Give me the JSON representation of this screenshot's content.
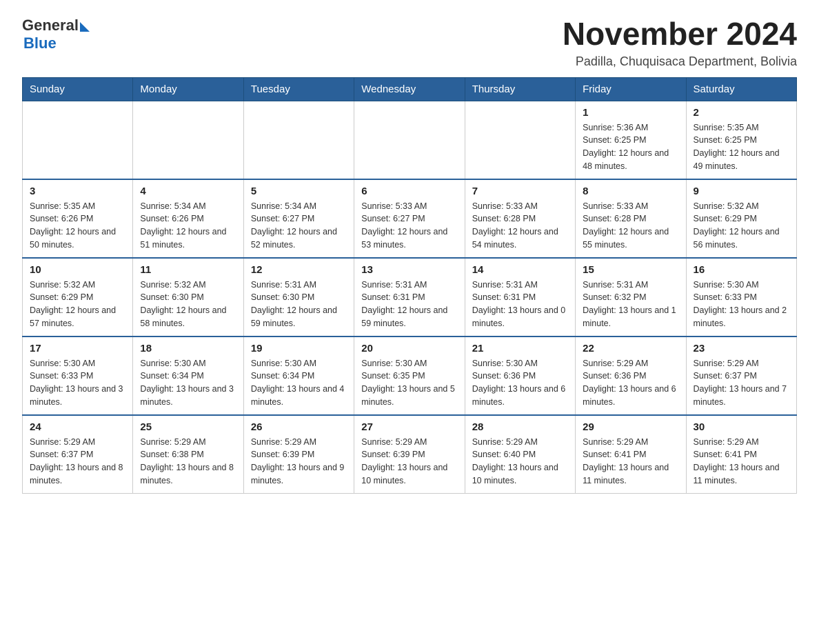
{
  "logo": {
    "general": "General",
    "blue": "Blue",
    "line2": "Blue"
  },
  "header": {
    "title": "November 2024",
    "subtitle": "Padilla, Chuquisaca Department, Bolivia"
  },
  "days_of_week": [
    "Sunday",
    "Monday",
    "Tuesday",
    "Wednesday",
    "Thursday",
    "Friday",
    "Saturday"
  ],
  "weeks": [
    [
      {
        "day": "",
        "info": ""
      },
      {
        "day": "",
        "info": ""
      },
      {
        "day": "",
        "info": ""
      },
      {
        "day": "",
        "info": ""
      },
      {
        "day": "",
        "info": ""
      },
      {
        "day": "1",
        "info": "Sunrise: 5:36 AM\nSunset: 6:25 PM\nDaylight: 12 hours and 48 minutes."
      },
      {
        "day": "2",
        "info": "Sunrise: 5:35 AM\nSunset: 6:25 PM\nDaylight: 12 hours and 49 minutes."
      }
    ],
    [
      {
        "day": "3",
        "info": "Sunrise: 5:35 AM\nSunset: 6:26 PM\nDaylight: 12 hours and 50 minutes."
      },
      {
        "day": "4",
        "info": "Sunrise: 5:34 AM\nSunset: 6:26 PM\nDaylight: 12 hours and 51 minutes."
      },
      {
        "day": "5",
        "info": "Sunrise: 5:34 AM\nSunset: 6:27 PM\nDaylight: 12 hours and 52 minutes."
      },
      {
        "day": "6",
        "info": "Sunrise: 5:33 AM\nSunset: 6:27 PM\nDaylight: 12 hours and 53 minutes."
      },
      {
        "day": "7",
        "info": "Sunrise: 5:33 AM\nSunset: 6:28 PM\nDaylight: 12 hours and 54 minutes."
      },
      {
        "day": "8",
        "info": "Sunrise: 5:33 AM\nSunset: 6:28 PM\nDaylight: 12 hours and 55 minutes."
      },
      {
        "day": "9",
        "info": "Sunrise: 5:32 AM\nSunset: 6:29 PM\nDaylight: 12 hours and 56 minutes."
      }
    ],
    [
      {
        "day": "10",
        "info": "Sunrise: 5:32 AM\nSunset: 6:29 PM\nDaylight: 12 hours and 57 minutes."
      },
      {
        "day": "11",
        "info": "Sunrise: 5:32 AM\nSunset: 6:30 PM\nDaylight: 12 hours and 58 minutes."
      },
      {
        "day": "12",
        "info": "Sunrise: 5:31 AM\nSunset: 6:30 PM\nDaylight: 12 hours and 59 minutes."
      },
      {
        "day": "13",
        "info": "Sunrise: 5:31 AM\nSunset: 6:31 PM\nDaylight: 12 hours and 59 minutes."
      },
      {
        "day": "14",
        "info": "Sunrise: 5:31 AM\nSunset: 6:31 PM\nDaylight: 13 hours and 0 minutes."
      },
      {
        "day": "15",
        "info": "Sunrise: 5:31 AM\nSunset: 6:32 PM\nDaylight: 13 hours and 1 minute."
      },
      {
        "day": "16",
        "info": "Sunrise: 5:30 AM\nSunset: 6:33 PM\nDaylight: 13 hours and 2 minutes."
      }
    ],
    [
      {
        "day": "17",
        "info": "Sunrise: 5:30 AM\nSunset: 6:33 PM\nDaylight: 13 hours and 3 minutes."
      },
      {
        "day": "18",
        "info": "Sunrise: 5:30 AM\nSunset: 6:34 PM\nDaylight: 13 hours and 3 minutes."
      },
      {
        "day": "19",
        "info": "Sunrise: 5:30 AM\nSunset: 6:34 PM\nDaylight: 13 hours and 4 minutes."
      },
      {
        "day": "20",
        "info": "Sunrise: 5:30 AM\nSunset: 6:35 PM\nDaylight: 13 hours and 5 minutes."
      },
      {
        "day": "21",
        "info": "Sunrise: 5:30 AM\nSunset: 6:36 PM\nDaylight: 13 hours and 6 minutes."
      },
      {
        "day": "22",
        "info": "Sunrise: 5:29 AM\nSunset: 6:36 PM\nDaylight: 13 hours and 6 minutes."
      },
      {
        "day": "23",
        "info": "Sunrise: 5:29 AM\nSunset: 6:37 PM\nDaylight: 13 hours and 7 minutes."
      }
    ],
    [
      {
        "day": "24",
        "info": "Sunrise: 5:29 AM\nSunset: 6:37 PM\nDaylight: 13 hours and 8 minutes."
      },
      {
        "day": "25",
        "info": "Sunrise: 5:29 AM\nSunset: 6:38 PM\nDaylight: 13 hours and 8 minutes."
      },
      {
        "day": "26",
        "info": "Sunrise: 5:29 AM\nSunset: 6:39 PM\nDaylight: 13 hours and 9 minutes."
      },
      {
        "day": "27",
        "info": "Sunrise: 5:29 AM\nSunset: 6:39 PM\nDaylight: 13 hours and 10 minutes."
      },
      {
        "day": "28",
        "info": "Sunrise: 5:29 AM\nSunset: 6:40 PM\nDaylight: 13 hours and 10 minutes."
      },
      {
        "day": "29",
        "info": "Sunrise: 5:29 AM\nSunset: 6:41 PM\nDaylight: 13 hours and 11 minutes."
      },
      {
        "day": "30",
        "info": "Sunrise: 5:29 AM\nSunset: 6:41 PM\nDaylight: 13 hours and 11 minutes."
      }
    ]
  ]
}
